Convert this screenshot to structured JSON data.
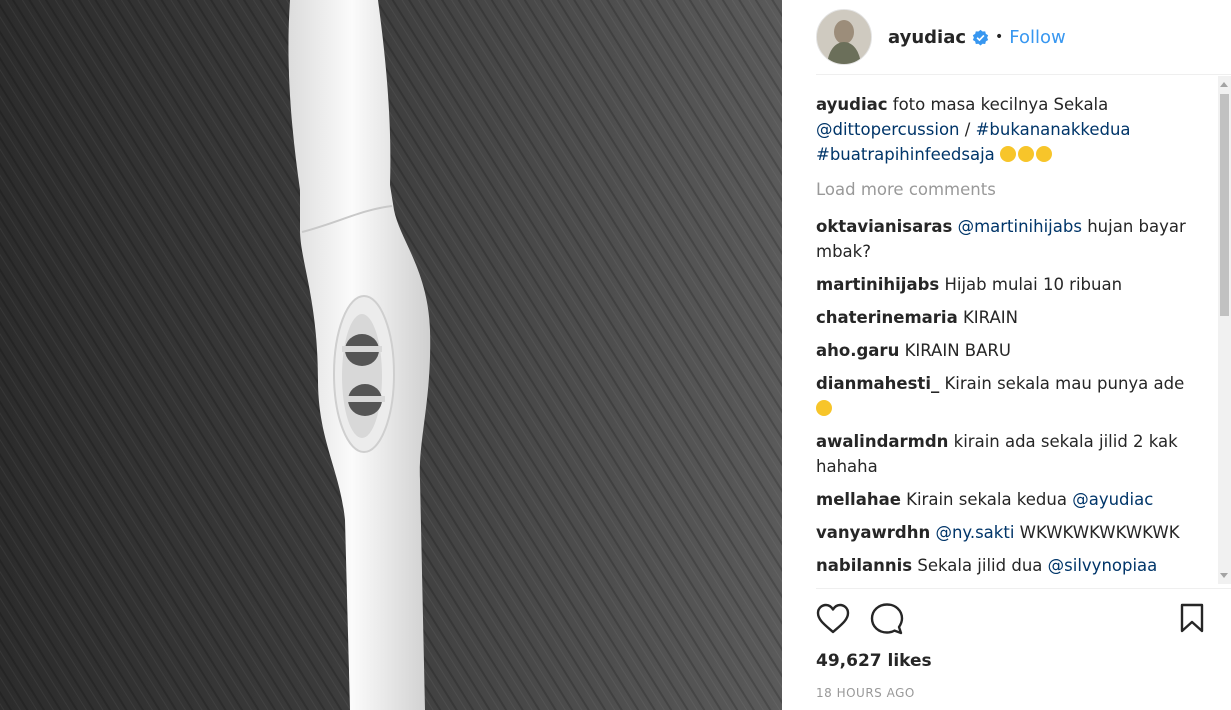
{
  "post": {
    "username": "ayudiac",
    "separator": "•",
    "follow_label": "Follow"
  },
  "caption": {
    "username": "ayudiac",
    "text": "foto masa kecilnya Sekala",
    "mention": "@dittopercussion",
    "slash": "/",
    "tag1": "#bukananakkedua",
    "tag2": "#buatrapihinfeedsaja"
  },
  "load_more_label": "Load more comments",
  "comments": [
    {
      "user": "oktavianisaras",
      "mention": "@martinihijabs",
      "text": "hujan bayar mbak?"
    },
    {
      "user": "martinihijabs",
      "text": "Hijab mulai 10 ribuan"
    },
    {
      "user": "chaterinemaria",
      "text": "KIRAIN"
    },
    {
      "user": "aho.garu",
      "text": "KIRAIN BARU"
    },
    {
      "user": "dianmahesti_",
      "text": "Kirain sekala mau punya ade"
    },
    {
      "user": "awalindarmdn",
      "text": "kirain ada sekala jilid 2 kak hahaha"
    },
    {
      "user": "mellahae",
      "text": "Kirain sekala kedua",
      "mention": "@ayudiac"
    },
    {
      "user": "vanyawrdhn",
      "mention": "@ny.sakti",
      "text": "WKWKWKWKWKWK"
    },
    {
      "user": "nabilannis",
      "text": "Sekala jilid dua",
      "mention": "@silvynopiaa"
    }
  ],
  "likes": "49,627 likes",
  "timestamp": "18 HOURS AGO",
  "icons": {
    "like": "heart-icon",
    "comment": "comment-bubble-icon",
    "save": "bookmark-icon",
    "verified": "verified-badge-icon"
  },
  "colors": {
    "link": "#003569",
    "follow": "#3897f0",
    "muted": "#999999"
  }
}
